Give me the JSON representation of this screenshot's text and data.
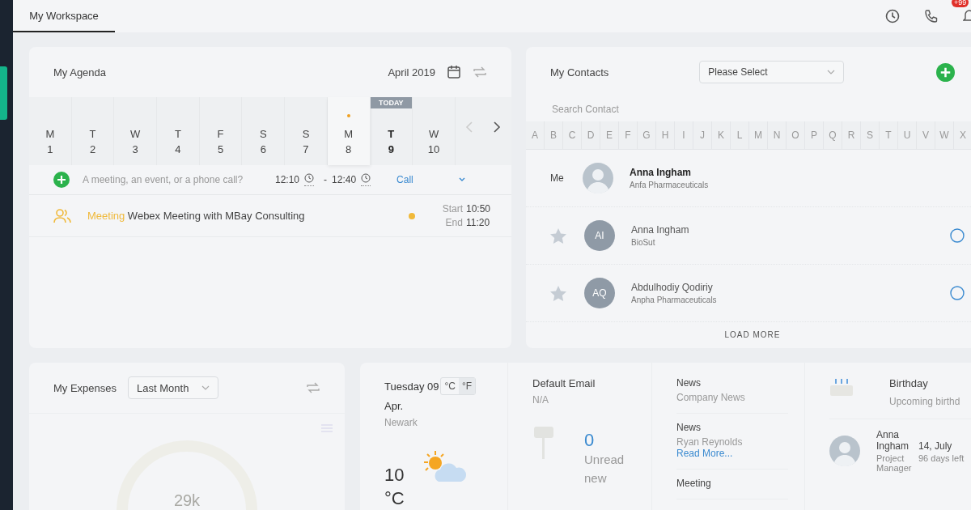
{
  "top_bar": {
    "tabs": [
      {
        "label": "My Workspace",
        "selected": true
      }
    ],
    "notification_badge": "+99"
  },
  "agenda": {
    "title": "My Agenda",
    "month": "April 2019",
    "today_label": "TODAY",
    "days": [
      {
        "weekday": "M",
        "date": "1",
        "selected": false,
        "today": false,
        "has_events": false
      },
      {
        "weekday": "T",
        "date": "2",
        "selected": false,
        "today": false,
        "has_events": false
      },
      {
        "weekday": "W",
        "date": "3",
        "selected": false,
        "today": false,
        "has_events": false
      },
      {
        "weekday": "T",
        "date": "4",
        "selected": false,
        "today": false,
        "has_events": false
      },
      {
        "weekday": "F",
        "date": "5",
        "selected": false,
        "today": false,
        "has_events": false
      },
      {
        "weekday": "S",
        "date": "6",
        "selected": false,
        "today": false,
        "has_events": false
      },
      {
        "weekday": "S",
        "date": "7",
        "selected": false,
        "today": false,
        "has_events": false
      },
      {
        "weekday": "M",
        "date": "8",
        "selected": true,
        "today": false,
        "has_events": true
      },
      {
        "weekday": "T",
        "date": "9",
        "selected": false,
        "today": true,
        "has_events": false
      },
      {
        "weekday": "W",
        "date": "10",
        "selected": false,
        "today": false,
        "has_events": false
      }
    ],
    "quick_add": {
      "placeholder": "A meeting, an event, or a phone call?",
      "start_time": "12:10",
      "separator": "-",
      "end_time": "12:40",
      "type": "Call"
    },
    "events": [
      {
        "kind_label": "Meeting",
        "title": "Webex Meeting with MBay Consulting",
        "color": "#f0b93a",
        "start_label": "Start",
        "start": "10:50",
        "end_label": "End",
        "end": "11:20"
      }
    ]
  },
  "contacts": {
    "title": "My Contacts",
    "filter_placeholder": "Please Select",
    "search_placeholder": "Search Contact",
    "letters": [
      "A",
      "B",
      "C",
      "D",
      "E",
      "F",
      "G",
      "H",
      "I",
      "J",
      "K",
      "L",
      "M",
      "N",
      "O",
      "P",
      "Q",
      "R",
      "S",
      "T",
      "U",
      "V",
      "W",
      "X"
    ],
    "me": {
      "label": "Me",
      "name": "Anna Ingham",
      "company": "Anfa Pharmaceuticals"
    },
    "items": [
      {
        "initials": "AI",
        "name": "Anna Ingham",
        "company": "BioSut",
        "starred": false
      },
      {
        "initials": "AQ",
        "name": "Abdulhodiy Qodiriy",
        "company": "Anpha Pharmaceuticals",
        "starred": false
      }
    ],
    "load_more": "LOAD MORE"
  },
  "expenses": {
    "title": "My Expenses",
    "period": "Last Month",
    "center_label": "29k"
  },
  "weather": {
    "date": "Tuesday 09",
    "month": "Apr.",
    "units": [
      {
        "label": "°C",
        "selected": false
      },
      {
        "label": "°F",
        "selected": true
      }
    ],
    "location": "Newark",
    "temperature": "10",
    "temperature_unit": "°C"
  },
  "email": {
    "title": "Default Email",
    "address": "N/A",
    "unread_count": "0",
    "unread_label": "Unread new"
  },
  "news": [
    {
      "title": "News",
      "text": "Company News"
    },
    {
      "title": "News",
      "text": "Ryan Reynolds",
      "link": "Read More..."
    },
    {
      "title": "Meeting"
    }
  ],
  "birthday": {
    "title": "Birthday",
    "subtitle": "Upcoming birthd",
    "person": {
      "name": "Anna Ingham",
      "date": "14, July",
      "role": "Project Manager",
      "days_left": "96 days left"
    }
  }
}
